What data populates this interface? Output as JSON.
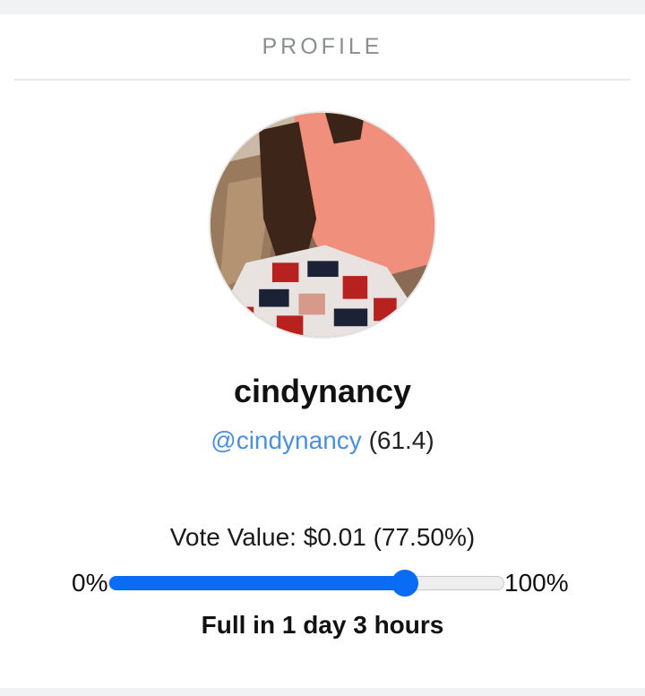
{
  "header": {
    "title": "PROFILE"
  },
  "profile": {
    "display_name": "cindynancy",
    "handle": "@cindynancy",
    "reputation": "(61.4)"
  },
  "vote": {
    "label": "Vote Value: $0.01 (77.50%)",
    "slider_min_label": "0%",
    "slider_max_label": "100%",
    "slider_value": 0.75,
    "recharge_text": "Full in 1 day 3 hours"
  },
  "colors": {
    "accent": "#0a6cf5",
    "link": "#4a90e2",
    "header_text": "#8a8d91"
  }
}
